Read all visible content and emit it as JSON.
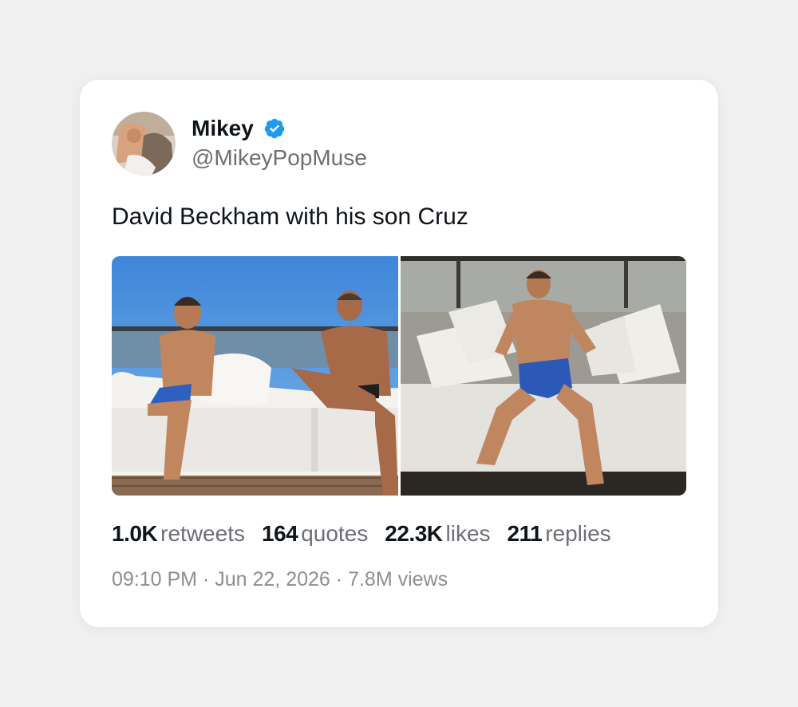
{
  "tweet": {
    "author": {
      "display_name": "Mikey",
      "handle": "@MikeyPopMuse",
      "verified": true
    },
    "text": "David Beckham with his son Cruz",
    "stats": [
      {
        "value": "1.0K",
        "label": "retweets"
      },
      {
        "value": "164",
        "label": "quotes"
      },
      {
        "value": "22.3K",
        "label": "likes"
      },
      {
        "value": "211",
        "label": "replies"
      }
    ],
    "time": "09:10 PM",
    "separator": "·",
    "date": "Jun 22, 2026",
    "views": "7.8M views"
  },
  "icons": {
    "verified_badge": "verified-check-icon"
  },
  "colors": {
    "verified_blue": "#1d9bf0",
    "background": "#f0f0f0",
    "card": "#ffffff",
    "text_primary": "#0f1419",
    "text_secondary": "#6b6f73"
  }
}
